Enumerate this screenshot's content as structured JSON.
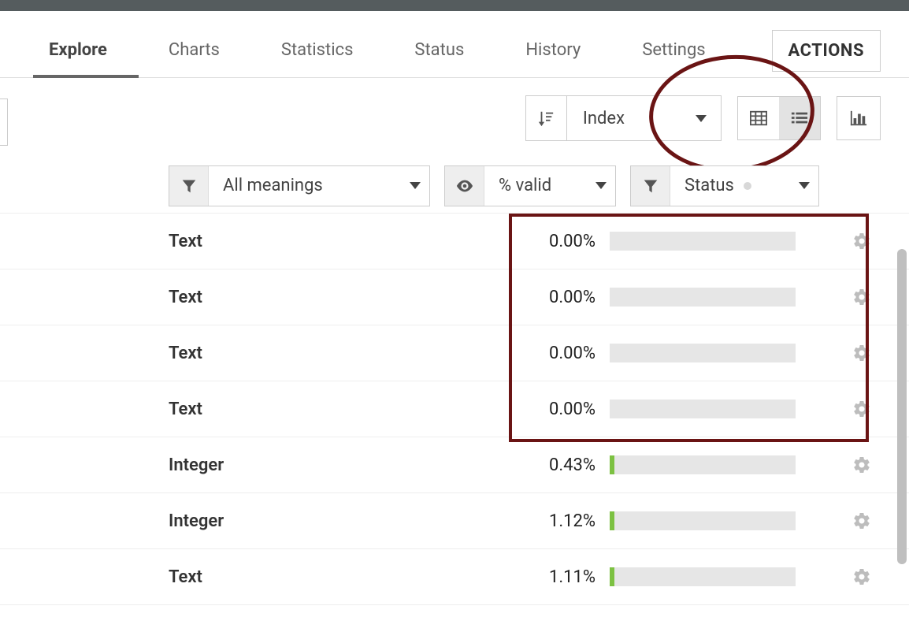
{
  "tabs": {
    "items": [
      {
        "label": "Explore",
        "active": true
      },
      {
        "label": "Charts"
      },
      {
        "label": "Statistics"
      },
      {
        "label": "Status"
      },
      {
        "label": "History"
      },
      {
        "label": "Settings"
      }
    ],
    "actions_label": "ACTIONS"
  },
  "toolbar": {
    "sort_field": "Index",
    "views": {
      "grid_active": false,
      "list_active": true
    }
  },
  "filters": {
    "meanings_label": "All meanings",
    "valid_label": "% valid",
    "status_label": "Status"
  },
  "rows": [
    {
      "type": "Text",
      "pct": "0.00%",
      "fill": 0.0
    },
    {
      "type": "Text",
      "pct": "0.00%",
      "fill": 0.0
    },
    {
      "type": "Text",
      "pct": "0.00%",
      "fill": 0.0
    },
    {
      "type": "Text",
      "pct": "0.00%",
      "fill": 0.0
    },
    {
      "type": "Integer",
      "pct": "0.43%",
      "fill": 0.0043
    },
    {
      "type": "Integer",
      "pct": "1.12%",
      "fill": 0.0112
    },
    {
      "type": "Text",
      "pct": "1.11%",
      "fill": 0.0111
    }
  ],
  "annotations": {
    "highlight_rows": 4
  }
}
